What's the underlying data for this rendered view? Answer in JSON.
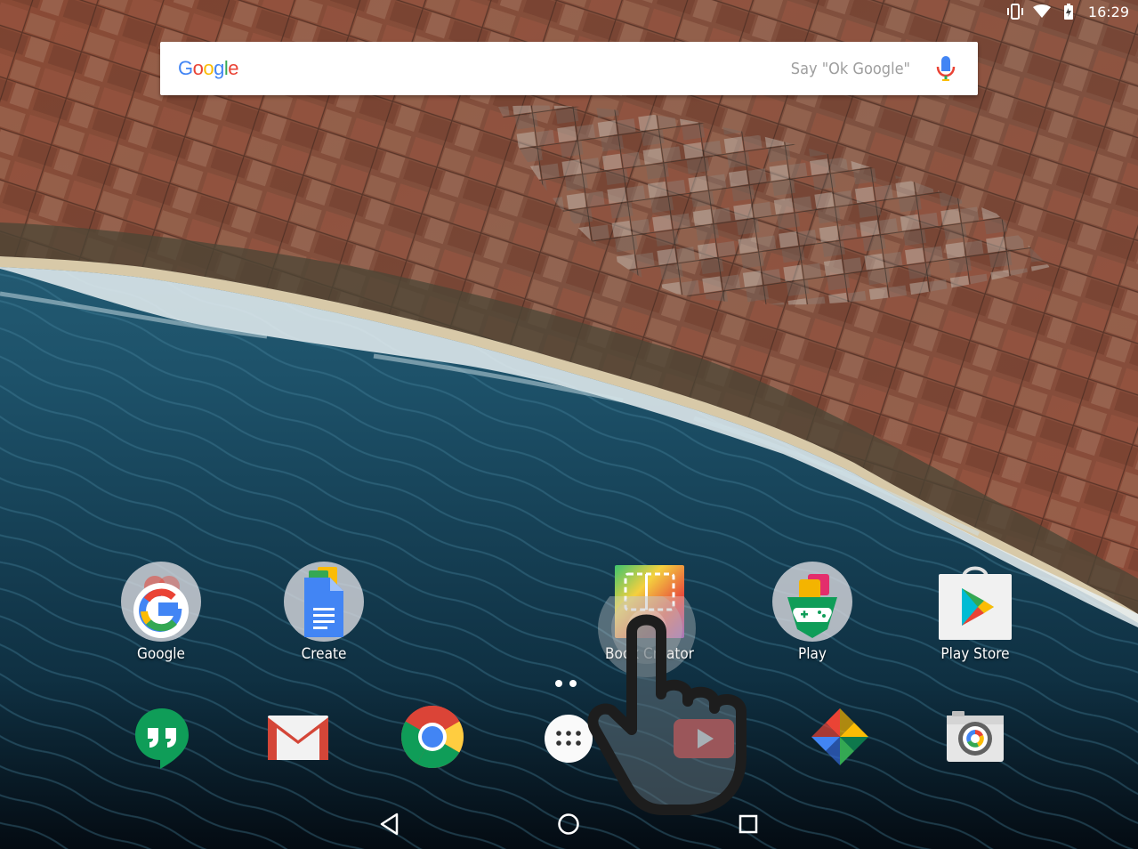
{
  "status_bar": {
    "icons": [
      "vibrate-icon",
      "wifi-icon",
      "battery-icon"
    ],
    "time": "16:29"
  },
  "search": {
    "logo_letters": [
      "G",
      "o",
      "o",
      "g",
      "l",
      "e"
    ],
    "hint": "Say \"Ok Google\"",
    "mic_icon": "mic-icon"
  },
  "home_apps": [
    {
      "label": "Google",
      "icon": "google-folder-icon"
    },
    {
      "label": "Create",
      "icon": "docs-folder-icon"
    },
    {
      "label": "Book Creator",
      "icon": "book-creator-icon"
    },
    {
      "label": "Play",
      "icon": "play-games-folder-icon"
    },
    {
      "label": "Play Store",
      "icon": "play-store-icon"
    }
  ],
  "page_indicator": {
    "pages": 2
  },
  "dock": [
    {
      "name": "hangouts",
      "icon": "hangouts-icon"
    },
    {
      "name": "gmail",
      "icon": "gmail-icon"
    },
    {
      "name": "chrome",
      "icon": "chrome-icon"
    },
    {
      "name": "app-drawer",
      "icon": "app-drawer-icon"
    },
    {
      "name": "youtube",
      "icon": "youtube-icon"
    },
    {
      "name": "photos",
      "icon": "photos-icon"
    },
    {
      "name": "camera",
      "icon": "camera-icon"
    }
  ],
  "nav_bar": [
    "back-icon",
    "home-icon",
    "recents-icon"
  ],
  "colors": {
    "google_blue": "#4285F4",
    "google_red": "#EA4335",
    "google_yellow": "#FBBC05",
    "google_green": "#34A853",
    "hangouts_green": "#0F9D58",
    "gmail_red": "#D44638",
    "youtube_red": "#E53935"
  }
}
